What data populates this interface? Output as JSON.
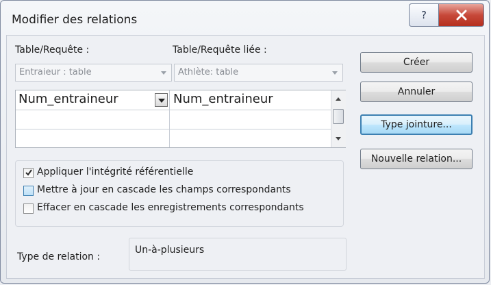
{
  "window": {
    "title": "Modifier des relations"
  },
  "left_label": "Table/Requête :",
  "right_label": "Table/Requête liée :",
  "left_combo": {
    "value": "Entraieur : table"
  },
  "right_combo": {
    "value": "Athlète: table"
  },
  "fields_grid": {
    "rows": [
      {
        "left": "Num_entraineur",
        "right": "Num_entraineur"
      },
      {
        "left": "",
        "right": ""
      },
      {
        "left": "",
        "right": ""
      }
    ]
  },
  "options": {
    "referential_integrity": {
      "label": "Appliquer l'intégrité référentielle",
      "checked": true
    },
    "cascade_update": {
      "label": "Mettre à jour en cascade les champs correspondants",
      "checked": false
    },
    "cascade_delete": {
      "label": "Effacer en cascade les enregistrements correspondants",
      "checked": false
    }
  },
  "relation_type": {
    "label": "Type de relation :",
    "value": "Un-à-plusieurs"
  },
  "buttons": {
    "create": "Créer",
    "cancel": "Annuler",
    "join_type": "Type jointure...",
    "new_relation": "Nouvelle relation..."
  },
  "icons": {
    "help": "help-icon",
    "close": "close-icon",
    "dropdown": "chevron-down-icon",
    "check": "check-icon"
  },
  "colors": {
    "close_button": "#c7493a",
    "focus_accent": "#3c7fb1"
  }
}
